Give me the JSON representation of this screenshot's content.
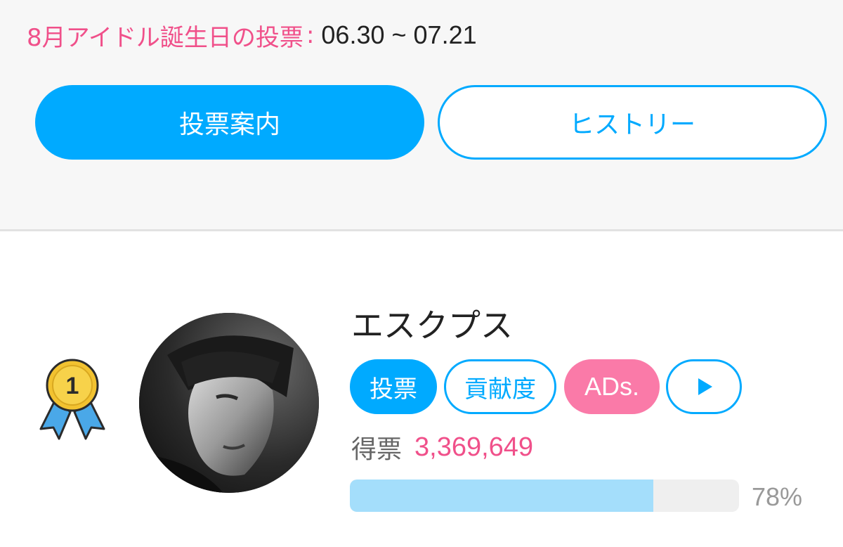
{
  "header": {
    "period_label": "8月アイドル誕生日の投票",
    "separator": ":",
    "period_dates": "06.30 ~ 07.21"
  },
  "buttons": {
    "guide_label": "投票案内",
    "history_label": "ヒストリー"
  },
  "ranking": {
    "rank": "1",
    "idol_name": "エスクプス",
    "actions": {
      "vote_label": "投票",
      "contribution_label": "貢献度",
      "ads_label": "ADs."
    },
    "votes_label": "得票",
    "votes_count": "3,369,649",
    "progress_percent": 78,
    "progress_text": "78%"
  },
  "colors": {
    "accent_blue": "#00aaff",
    "accent_pink": "#f0508a",
    "ads_pink": "#fa7aa8",
    "progress_fill": "#a4defb",
    "medal_gold": "#f2c230",
    "ribbon_blue": "#4aa8e8"
  },
  "icons": {
    "medal": "gold-medal-icon",
    "play": "play-icon"
  }
}
